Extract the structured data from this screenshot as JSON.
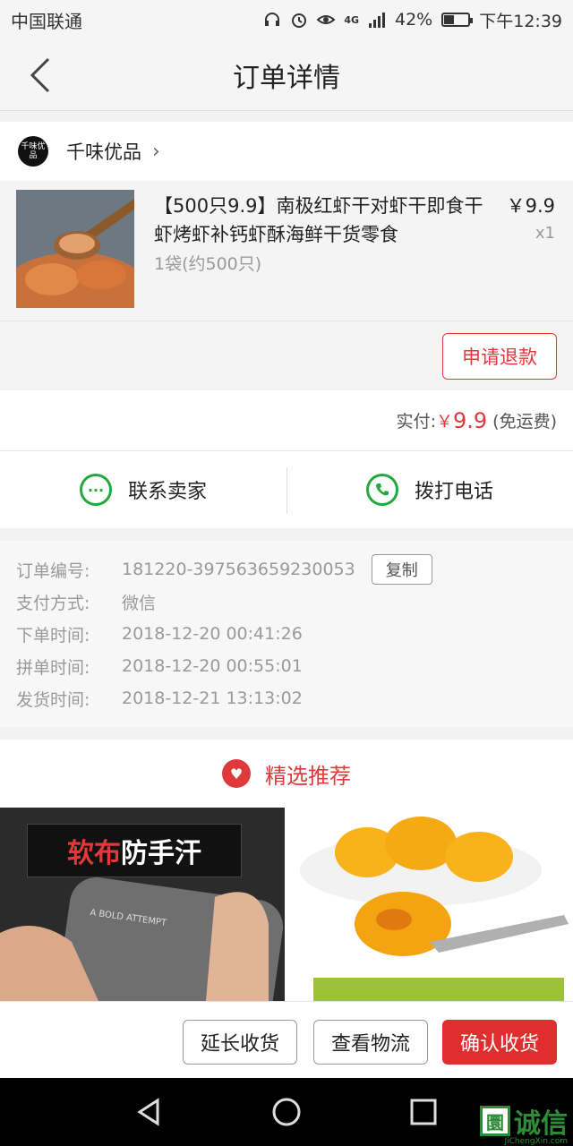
{
  "status_bar": {
    "carrier": "中国联通",
    "network": "4G",
    "battery": "42%",
    "battery_level": 0.42,
    "time": "下午12:39"
  },
  "nav": {
    "title": "订单详情"
  },
  "shop": {
    "logo_text": "千味优品",
    "name": "千味优品"
  },
  "product": {
    "title": "【500只9.9】南极红虾干对虾干即食干虾烤虾补钙虾酥海鲜干货零食",
    "spec": "1袋(约500只)",
    "price": "￥9.9",
    "qty": "x1"
  },
  "refund_button": "申请退款",
  "payment": {
    "label": "实付:",
    "currency": "￥",
    "amount": "9.9",
    "note": "(免运费)"
  },
  "contact": {
    "seller_label": "联系卖家",
    "phone_label": "拨打电话"
  },
  "order_info": [
    {
      "label": "订单编号:",
      "value": "181220-397563659230053"
    },
    {
      "label": "支付方式:",
      "value": "微信"
    },
    {
      "label": "下单时间:",
      "value": "2018-12-20 00:41:26"
    },
    {
      "label": "拼单时间:",
      "value": "2018-12-20 00:55:01"
    },
    {
      "label": "发货时间:",
      "value": "2018-12-21 13:13:02"
    }
  ],
  "copy_button": "复制",
  "recommend": {
    "title": "精选推荐",
    "item1_banner_red": "软布",
    "item1_banner_rest": "防手汗",
    "item1_tag": "A BOLD ATTEMPT"
  },
  "actions": {
    "extend": "延长收货",
    "track": "查看物流",
    "confirm": "确认收货"
  },
  "watermark": {
    "logo": "圜",
    "text": "诚信",
    "sub": "JiChengXin.com"
  },
  "colors": {
    "accent": "#e0393b",
    "green": "#25a83b"
  }
}
